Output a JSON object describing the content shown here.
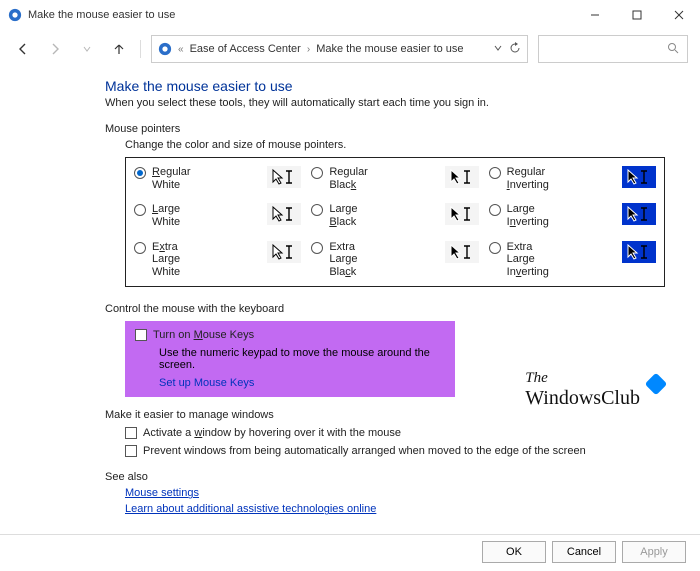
{
  "titlebar": {
    "title": "Make the mouse easier to use"
  },
  "breadcrumb": {
    "leftChevron": "«",
    "item1": "Ease of Access Center",
    "item2": "Make the mouse easier to use"
  },
  "page": {
    "title": "Make the mouse easier to use",
    "sub": "When you select these tools, they will automatically start each time you sign in."
  },
  "mousePointers": {
    "label": "Mouse pointers",
    "caption": "Change the color and size of mouse pointers.",
    "options": [
      {
        "pre": "",
        "ul": "R",
        "post": "egular White",
        "selected": true,
        "inv": false,
        "fill": "#fff",
        "stroke": "#000"
      },
      {
        "pre": "Regular Blac",
        "ul": "k",
        "post": "",
        "selected": false,
        "inv": false,
        "fill": "#000",
        "stroke": "#fff"
      },
      {
        "pre": "Regular ",
        "ul": "I",
        "post": "nverting",
        "selected": false,
        "inv": true,
        "fill": "#000",
        "stroke": "#fff"
      },
      {
        "pre": "",
        "ul": "L",
        "post": "arge White",
        "selected": false,
        "inv": false,
        "fill": "#fff",
        "stroke": "#000"
      },
      {
        "pre": "Large ",
        "ul": "B",
        "post": "lack",
        "selected": false,
        "inv": false,
        "fill": "#000",
        "stroke": "#fff"
      },
      {
        "pre": "Large I",
        "ul": "n",
        "post": "verting",
        "selected": false,
        "inv": true,
        "fill": "#000",
        "stroke": "#fff"
      },
      {
        "pre": "E",
        "ul": "x",
        "post": "tra Large White",
        "selected": false,
        "inv": false,
        "fill": "#fff",
        "stroke": "#000"
      },
      {
        "pre": "Extra Large Bla",
        "ul": "c",
        "post": "k",
        "selected": false,
        "inv": false,
        "fill": "#000",
        "stroke": "#fff"
      },
      {
        "pre": "Extra Large In",
        "ul": "v",
        "post": "erting",
        "selected": false,
        "inv": true,
        "fill": "#000",
        "stroke": "#fff"
      }
    ]
  },
  "keyboard": {
    "label": "Control the mouse with the keyboard",
    "checkPre": "Turn on ",
    "checkUl": "M",
    "checkPost": "ouse Keys",
    "desc": "Use the numeric keypad to move the mouse around the screen.",
    "setup": "Set up Mouse Keys"
  },
  "manage": {
    "label": "Make it easier to manage windows",
    "opt1Pre": "Activate a ",
    "opt1Ul": "w",
    "opt1Post": "indow by hovering over it with the mouse",
    "opt2": "Prevent windows from being automatically arranged when moved to the edge of the screen"
  },
  "seealso": {
    "label": "See also",
    "link1": "Mouse settings",
    "link2": "Learn about additional assistive technologies online"
  },
  "buttons": {
    "ok": "OK",
    "cancel": "Cancel",
    "apply": "Apply"
  },
  "watermark": {
    "line1": "The",
    "line2": "WindowsClub"
  }
}
